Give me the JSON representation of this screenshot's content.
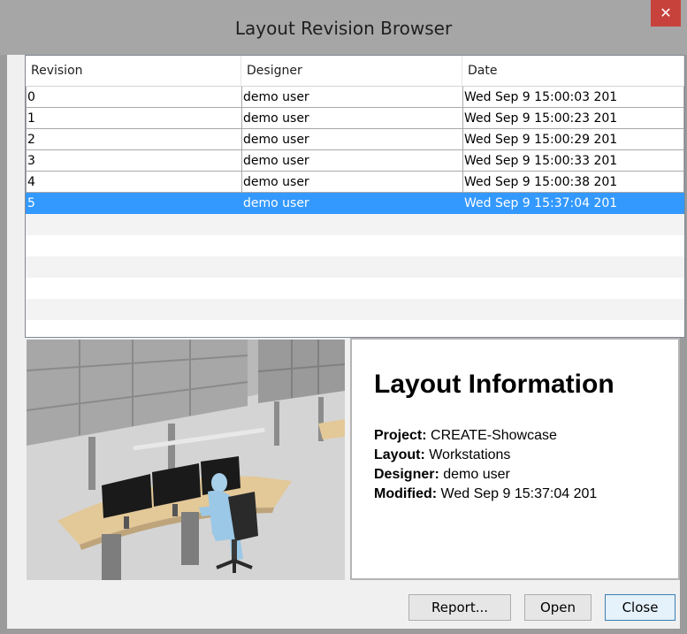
{
  "window": {
    "title": "Layout Revision Browser",
    "close_glyph": "✕"
  },
  "table": {
    "columns": [
      "Revision",
      "Designer",
      "Date"
    ],
    "rows": [
      [
        "0",
        "demo user",
        "Wed Sep 9 15:00:03 201"
      ],
      [
        "1",
        "demo user",
        "Wed Sep 9 15:00:23 201"
      ],
      [
        "2",
        "demo user",
        "Wed Sep 9 15:00:29 201"
      ],
      [
        "3",
        "demo user",
        "Wed Sep 9 15:00:33 201"
      ],
      [
        "4",
        "demo user",
        "Wed Sep 9 15:00:38 201"
      ],
      [
        "5",
        "demo user",
        "Wed Sep 9 15:37:04 201"
      ]
    ],
    "selected_index": 5
  },
  "info": {
    "title": "Layout Information",
    "project_label": "Project:",
    "project": "CREATE-Showcase",
    "layout_label": "Layout:",
    "layout": "Workstations",
    "designer_label": "Designer:",
    "designer": "demo user",
    "modified_label": "Modified:",
    "modified": "Wed Sep 9 15:37:04 201"
  },
  "buttons": {
    "report": "Report...",
    "open": "Open",
    "close": "Close"
  },
  "colors": {
    "selection": "#3399ff",
    "titlebar": "#a6a6a6",
    "close": "#c8423c"
  }
}
